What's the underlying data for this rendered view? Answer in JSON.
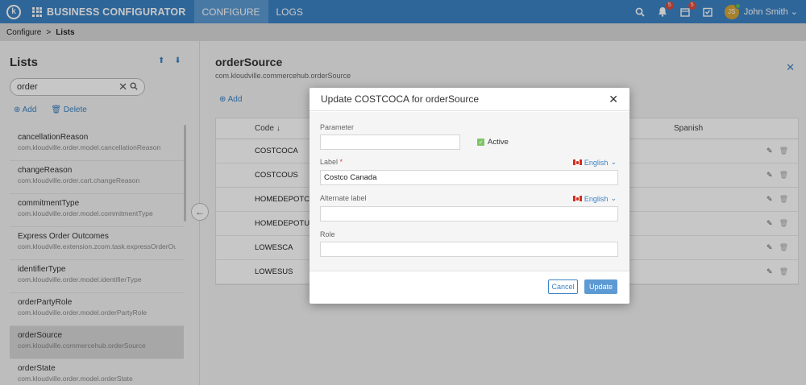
{
  "header": {
    "app_title": "BUSINESS CONFIGURATOR",
    "logo_letter": "k",
    "tabs": [
      {
        "label": "CONFIGURE",
        "active": true
      },
      {
        "label": "LOGS",
        "active": false
      }
    ],
    "notifications_badge": "5",
    "tasks_badge": "5",
    "user_initials": "JS",
    "user_name": "John Smith"
  },
  "breadcrumb": {
    "parent": "Configure",
    "separator": ">",
    "current": "Lists"
  },
  "sidebar": {
    "title": "Lists",
    "search_value": "order",
    "add_label": "Add",
    "delete_label": "Delete",
    "items": [
      {
        "name": "cancellationReason",
        "pkg": "com.kloudville.order.model.cancellationReason"
      },
      {
        "name": "changeReason",
        "pkg": "com.kloudville.order.cart.changeReason"
      },
      {
        "name": "commitmentType",
        "pkg": "com.kloudville.order.model.commitmentType"
      },
      {
        "name": "Express Order Outcomes",
        "pkg": "com.kloudville.extension.zcom.task.expressOrderOut"
      },
      {
        "name": "identifierType",
        "pkg": "com.kloudville.order.model.identifierType"
      },
      {
        "name": "orderPartyRole",
        "pkg": "com.kloudville.order.model.orderPartyRole"
      },
      {
        "name": "orderSource",
        "pkg": "com.kloudville.commercehub.orderSource"
      },
      {
        "name": "orderState",
        "pkg": "com.kloudville.order.model.orderState"
      }
    ],
    "selected_index": 6
  },
  "main": {
    "title": "orderSource",
    "subtitle": "com.kloudville.commercehub.orderSource",
    "add_label": "Add",
    "table": {
      "col_code": "Code",
      "col_spanish": "Spanish",
      "rows": [
        "COSTCOCA",
        "COSTCOUS",
        "HOMEDEPOTCA",
        "HOMEDEPOTUS",
        "LOWESCA",
        "LOWESUS"
      ]
    }
  },
  "modal": {
    "title": "Update COSTCOCA for orderSource",
    "parameter_label": "Parameter",
    "parameter_value": "",
    "active_label": "Active",
    "label_label": "Label",
    "label_required_mark": "*",
    "label_value": "Costco Canada",
    "language": "English",
    "alt_label_label": "Alternate label",
    "alt_label_value": "",
    "alt_language": "English",
    "role_label": "Role",
    "role_value": "",
    "cancel_label": "Cancel",
    "update_label": "Update"
  },
  "colors": {
    "primary": "#3d83c5",
    "badge": "#e14b3b",
    "active_check": "#7dc466"
  }
}
